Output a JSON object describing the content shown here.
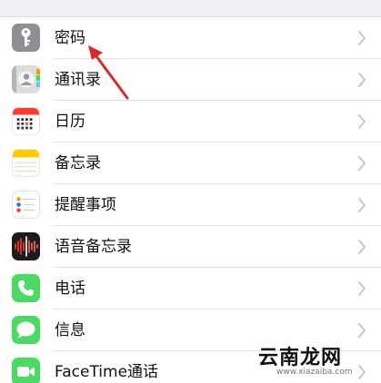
{
  "settings": {
    "items": [
      {
        "label": "密码",
        "icon": "key-icon",
        "color": "#8e8e93"
      },
      {
        "label": "通讯录",
        "icon": "contacts-icon",
        "color": "#c7c7c7"
      },
      {
        "label": "日历",
        "icon": "calendar-icon",
        "color": "#ff3b30"
      },
      {
        "label": "备忘录",
        "icon": "notes-icon",
        "color": "#ffcc00"
      },
      {
        "label": "提醒事项",
        "icon": "reminders-icon",
        "color": "#ffffff"
      },
      {
        "label": "语音备忘录",
        "icon": "voice-memos-icon",
        "color": "#1c1c1e"
      },
      {
        "label": "电话",
        "icon": "phone-icon",
        "color": "#4cd964"
      },
      {
        "label": "信息",
        "icon": "messages-icon",
        "color": "#4cd964"
      },
      {
        "label": "FaceTime通话",
        "icon": "facetime-icon",
        "color": "#4cd964"
      }
    ]
  },
  "watermark": {
    "text": "云南龙网",
    "url": "www.xiazaiba.com"
  },
  "colors": {
    "annotation_arrow": "#d62a2a",
    "separator": "#e1e1e6",
    "chevron": "#c7c7cc"
  }
}
